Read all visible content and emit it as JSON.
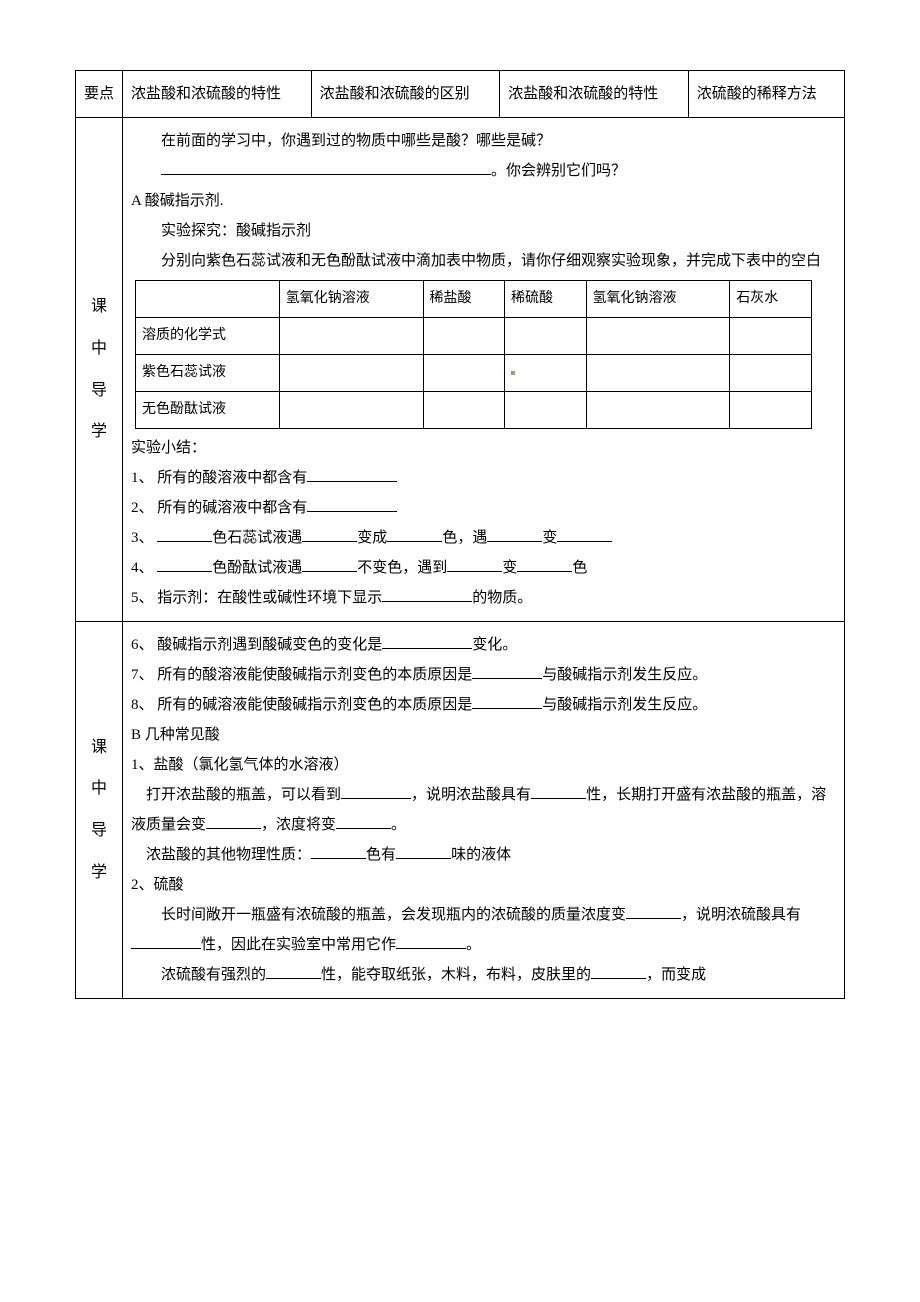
{
  "header": {
    "row_label": "要点",
    "c1": "浓盐酸和浓硫酸的特性",
    "c2": "浓盐酸和浓硫酸的区别",
    "c3": "浓盐酸和浓硫酸的特性",
    "c4": "浓硫酸的稀释方法"
  },
  "side": {
    "mid": "课中导学",
    "bottom": "课中导学"
  },
  "mid": {
    "intro_q": "在前面的学习中，你遇到过的物质中哪些是酸？哪些是碱？",
    "intro_tail": "。你会辨别它们吗？",
    "A_title": "A 酸碱指示剂.",
    "exp_title": "实验探究：酸碱指示剂",
    "exp_desc": "分别向紫色石蕊试液和无色酚酞试液中滴加表中物质，请你仔细观察实验现象，并完成下表中的空白",
    "table": {
      "cols": [
        "",
        "氢氧化钠溶液",
        "稀盐酸",
        "稀硫酸",
        "氢氧化钠溶液",
        "石灰水"
      ],
      "rows": [
        "溶质的化学式",
        "紫色石蕊试液",
        "无色酚酞试液"
      ]
    },
    "summary_title": "实验小结：",
    "s1_a": "1、 所有的酸溶液中都含有",
    "s2_a": "2、 所有的碱溶液中都含有",
    "s3_a": "3、 ",
    "s3_b": "色石蕊试液遇",
    "s3_c": "变成",
    "s3_d": "色，遇",
    "s3_e": "变",
    "s4_a": "4、 ",
    "s4_b": "色酚酞试液遇",
    "s4_c": "不变色，遇到",
    "s4_d": "变",
    "s4_e": "色",
    "s5_a": "5、 指示剂：在酸性或碱性环境下显示",
    "s5_b": "的物质。"
  },
  "bot": {
    "s6_a": "6、 酸碱指示剂遇到酸碱变色的变化是",
    "s6_b": "变化。",
    "s7_a": "7、 所有的酸溶液能使酸碱指示剂变色的本质原因是",
    "s7_b": "与酸碱指示剂发生反应。",
    "s8_a": "8、 所有的碱溶液能使酸碱指示剂变色的本质原因是",
    "s8_b": "与酸碱指示剂发生反应。",
    "B_title": "B 几种常见酸",
    "b1_title": "1、盐酸（氯化氢气体的水溶液）",
    "b1_a": "打开浓盐酸的瓶盖，可以看到",
    "b1_b": "，说明浓盐酸具有",
    "b1_c": "性，长期打开盛有浓盐酸的瓶盖，溶液质量会变",
    "b1_d": "，浓度将变",
    "b1_e": "。",
    "b1_2a": "浓盐酸的其他物理性质：",
    "b1_2b": "色有",
    "b1_2c": "味的液体",
    "b2_title": "2、硫酸",
    "b2_a": "长时间敞开一瓶盛有浓硫酸的瓶盖，会发现瓶内的浓硫酸的质量浓度变",
    "b2_b": "，说明浓硫酸具有",
    "b2_c": "性，因此在实验室中常用它作",
    "b2_d": "。",
    "b2_2a": "浓硫酸有强烈的",
    "b2_2b": "性，能夺取纸张，木料，布料，皮肤里的",
    "b2_2c": "，而变成"
  }
}
